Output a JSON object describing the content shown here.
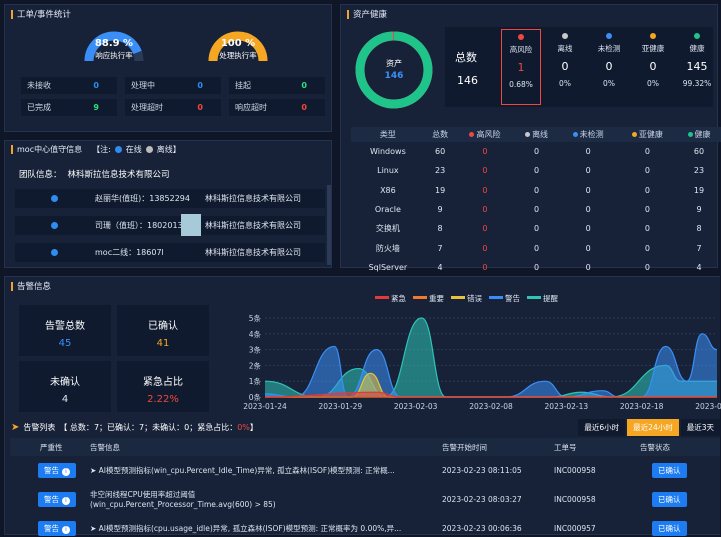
{
  "ticket": {
    "title": "工单/事件统计",
    "gauge1": {
      "value": "88.9 %",
      "label": "响应执行率",
      "fraction": 0.889,
      "color": "#3a8ff7"
    },
    "gauge2": {
      "value": "100 %",
      "label": "处理执行率",
      "fraction": 1.0,
      "color": "#f5a623"
    },
    "cells": [
      {
        "label": "未接收",
        "value": "0",
        "color": "#2f8cf0"
      },
      {
        "label": "处理中",
        "value": "0",
        "color": "#2f8cf0"
      },
      {
        "label": "挂起",
        "value": "0",
        "color": "#2ee07a"
      },
      {
        "label": "已完成",
        "value": "9",
        "color": "#2ee07a"
      },
      {
        "label": "处理超时",
        "value": "0",
        "color": "#f0483e"
      },
      {
        "label": "响应超时",
        "value": "0",
        "color": "#f0483e"
      }
    ]
  },
  "moc": {
    "title": "moc中心值守信息",
    "legend_prefix": "【注:",
    "legend_online": "在线",
    "legend_offline": "离线】",
    "team_label": "团队信息：",
    "team_name": "林科斯拉信息技术有限公司",
    "rows": [
      {
        "name": "赵丽华(值班)：13852294",
        "company": "林科斯拉信息技术有限公司"
      },
      {
        "name": "司珊（值班）：18020137",
        "company": "林科斯拉信息技术有限公司"
      },
      {
        "name": "moc二线：18607l",
        "company": "林科斯拉信息技术有限公司"
      }
    ]
  },
  "asset": {
    "title": "资产健康",
    "ring_label": "资产",
    "ring_value": "146",
    "total_label": "总数",
    "total_value": "146",
    "healthy_fraction": 0.9932,
    "summary": [
      {
        "label": "高风险",
        "value": "1",
        "pct": "0.68%",
        "color": "#f0483e",
        "dot": "#f0483e"
      },
      {
        "label": "离线",
        "value": "0",
        "pct": "0%",
        "color": "#ffffff",
        "dot": "#c8c8c8"
      },
      {
        "label": "未检测",
        "value": "0",
        "pct": "0%",
        "color": "#ffffff",
        "dot": "#3a8ff7"
      },
      {
        "label": "亚健康",
        "value": "0",
        "pct": "0%",
        "color": "#ffffff",
        "dot": "#f5a623"
      },
      {
        "label": "健康",
        "value": "145",
        "pct": "99.32%",
        "color": "#ffffff",
        "dot": "#1fc48a"
      }
    ],
    "headers": [
      "类型",
      "总数",
      "高风险",
      "离线",
      "未检测",
      "亚健康",
      "健康"
    ],
    "header_dots": [
      "",
      "",
      "#f0483e",
      "#c8c8c8",
      "#3a8ff7",
      "#f5a623",
      "#1fc48a"
    ],
    "rows": [
      [
        "Windows",
        "60",
        "0",
        "0",
        "0",
        "0",
        "60"
      ],
      [
        "Linux",
        "23",
        "0",
        "0",
        "0",
        "0",
        "23"
      ],
      [
        "X86",
        "19",
        "0",
        "0",
        "0",
        "0",
        "19"
      ],
      [
        "Oracle",
        "9",
        "0",
        "0",
        "0",
        "0",
        "9"
      ],
      [
        "交换机",
        "8",
        "0",
        "0",
        "0",
        "0",
        "8"
      ],
      [
        "防火墙",
        "7",
        "0",
        "0",
        "0",
        "0",
        "7"
      ],
      [
        "SqlServer",
        "4",
        "0",
        "0",
        "0",
        "0",
        "4"
      ]
    ]
  },
  "alarm": {
    "title": "告警信息",
    "stats": [
      {
        "label": "告警总数",
        "value": "45",
        "color": "#3a8ff7"
      },
      {
        "label": "已确认",
        "value": "41",
        "color": "#f5a623"
      },
      {
        "label": "未确认",
        "value": "4",
        "color": "#dfe6f2"
      },
      {
        "label": "紧急占比",
        "value": "2.22%",
        "color": "#f0483e"
      }
    ],
    "list_title": "告警列表",
    "list_summary_parts": [
      "【 总数：",
      "7",
      "；已确认：",
      "7",
      "；未确认：",
      "0",
      "；紧急占比：",
      "0%",
      "】"
    ],
    "filters": [
      {
        "label": "最近6小时",
        "active": false
      },
      {
        "label": "最近24小时",
        "active": true
      },
      {
        "label": "最近3天",
        "active": false
      }
    ],
    "columns": [
      "严重性",
      "告警信息",
      "告警开始时间",
      "工单号",
      "告警状态"
    ],
    "rows": [
      {
        "severity": "警告",
        "info": "➤ AI模型预测指标(win_cpu.Percent_Idle_Time)异常, 孤立森林(ISOF)模型预测: 正常概...",
        "time": "2023-02-23 08:11:05",
        "ticket": "INC000958",
        "status": "已确认"
      },
      {
        "severity": "警告",
        "info": "非空闲线程CPU使用率超过阈值",
        "info2": "(win_cpu.Percent_Processor_Time.avg(600) > 85)",
        "time": "2023-02-23 08:03:27",
        "ticket": "INC000958",
        "status": "已确认"
      },
      {
        "severity": "警告",
        "info": "➤ AI模型预测指标(cpu.usage_idle)异常, 孤立森林(ISOF)模型预测: 正常概率为 0.00%,异...",
        "time": "2023-02-23 00:06:36",
        "ticket": "INC000957",
        "status": "已确认"
      }
    ]
  },
  "chart_data": {
    "type": "area",
    "legend": [
      {
        "name": "紧急",
        "color": "#e03a3a"
      },
      {
        "name": "重要",
        "color": "#f07a2a"
      },
      {
        "name": "错误",
        "color": "#e8c23a"
      },
      {
        "name": "警告",
        "color": "#3a8ff7"
      },
      {
        "name": "提醒",
        "color": "#2ec4b6"
      }
    ],
    "legend_placement": "top",
    "ytick_labels": [
      "0条",
      "1条",
      "2条",
      "3条",
      "4条",
      "5条"
    ],
    "ylim": [
      0,
      5
    ],
    "xtick_labels": [
      "2023-01-24",
      "2023-01-29",
      "2023-02-03",
      "2023-02-08",
      "2023-02-13",
      "2023-02-18",
      "2023-02-23"
    ],
    "x_range_days": 30,
    "series": [
      {
        "name": "提醒",
        "color": "#2ec4b6",
        "values": [
          [
            0,
            1
          ],
          [
            3.5,
            0
          ],
          [
            6.2,
            1.8
          ],
          [
            8,
            0
          ],
          [
            10.4,
            5
          ],
          [
            12,
            0
          ],
          [
            19,
            0
          ],
          [
            21,
            0.3
          ],
          [
            23,
            0
          ],
          [
            26.6,
            2
          ],
          [
            27.6,
            1
          ],
          [
            30,
            1
          ]
        ]
      },
      {
        "name": "警告",
        "color": "#3a8ff7",
        "values": [
          [
            0,
            0.2
          ],
          [
            2,
            0
          ],
          [
            4.6,
            3.2
          ],
          [
            5.5,
            0
          ],
          [
            7.4,
            3
          ],
          [
            9,
            0
          ],
          [
            16,
            0
          ],
          [
            18.6,
            1
          ],
          [
            20,
            0
          ],
          [
            22.4,
            0.4
          ],
          [
            23.5,
            0
          ],
          [
            25,
            0
          ],
          [
            26.6,
            3.2
          ],
          [
            28,
            1
          ],
          [
            29,
            4
          ],
          [
            30,
            3
          ]
        ]
      },
      {
        "name": "错误",
        "color": "#e8c23a",
        "values": [
          [
            0,
            0
          ],
          [
            5.8,
            0
          ],
          [
            7,
            1.5
          ],
          [
            8.2,
            0
          ],
          [
            30,
            0
          ]
        ]
      },
      {
        "name": "重要",
        "color": "#f07a2a",
        "values": [
          [
            0,
            0
          ],
          [
            30,
            0
          ]
        ]
      },
      {
        "name": "紧急",
        "color": "#e03a3a",
        "values": [
          [
            0,
            0
          ],
          [
            7.4,
            0.3
          ],
          [
            9,
            0
          ],
          [
            30,
            0
          ]
        ]
      }
    ]
  }
}
